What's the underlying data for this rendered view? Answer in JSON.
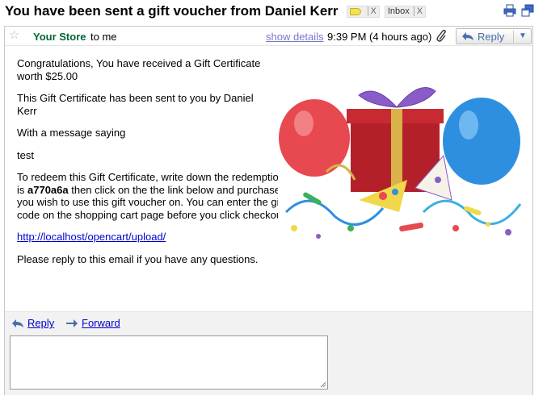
{
  "subject": "You have been sent a gift voucher from Daniel Kerr",
  "labels": [
    {
      "name": "",
      "remove": "X"
    },
    {
      "name": "Inbox",
      "remove": "X"
    }
  ],
  "header": {
    "sender": "Your Store",
    "to_me": "to me",
    "show_details": "show details",
    "time": "9:39 PM (4 hours ago)",
    "reply_label": "Reply"
  },
  "message": {
    "p1": "Congratulations, You have received a Gift Certificate worth $25.00",
    "p2": "This Gift Certificate has been sent to you by Daniel Kerr",
    "p3": "With a message saying",
    "p4": "test",
    "p5_pre": "To redeem this Gift Certificate, write down the redemption code which is ",
    "code": "a770a6a",
    "p5_post": " then click on the the link below and purchase the product you wish to use this gift voucher on. You can enter the gift voucher code on the shopping cart page before you click checkout.",
    "link": "http://localhost/opencart/upload/",
    "p6": "Please reply to this email if you have any questions."
  },
  "actions": {
    "reply": "Reply",
    "forward": "Forward"
  },
  "reply_box": {
    "value": ""
  },
  "colors": {
    "sender": "#006633",
    "link": "#0000cc",
    "show_details": "#7777cc",
    "reply_area_bg": "#f2f2f2"
  },
  "icons": [
    "star-icon",
    "print-icon",
    "new-window-icon",
    "paperclip-icon",
    "reply-arrow-icon",
    "forward-arrow-icon",
    "dropdown-icon",
    "label-tag-icon"
  ]
}
